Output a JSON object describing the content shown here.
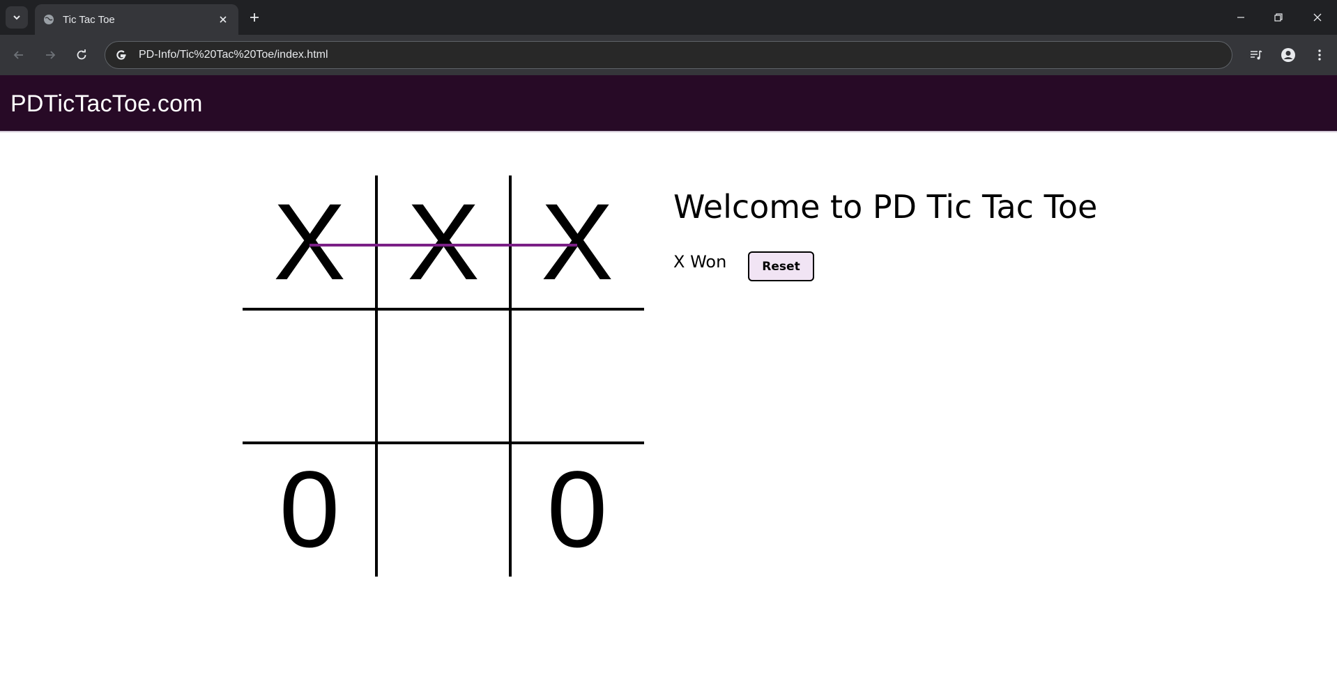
{
  "browser": {
    "tab_title": "Tic Tac Toe",
    "url": "PD-Info/Tic%20Tac%20Toe/index.html",
    "icons": {
      "tab_search": "chevron-down-icon",
      "favicon": "globe-icon",
      "tab_close": "close-icon",
      "new_tab": "plus-icon",
      "back": "arrow-left-icon",
      "forward": "arrow-right-icon",
      "reload": "reload-icon",
      "site_info": "google-icon",
      "media": "media-control-icon",
      "profile": "profile-icon",
      "menu": "kebab-menu-icon",
      "minimize": "minimize-icon",
      "restore": "restore-icon",
      "close_window": "close-window-icon"
    }
  },
  "site": {
    "brand": "PDTicTacToe.com",
    "header_color": "#270a26"
  },
  "game": {
    "board": [
      [
        "X",
        "X",
        "X"
      ],
      [
        "",
        "",
        ""
      ],
      [
        "0",
        "",
        "0"
      ]
    ],
    "winning_line": "top-row",
    "winning_line_color": "#7b1f86"
  },
  "info": {
    "heading": "Welcome to PD Tic Tac Toe",
    "status": "X Won",
    "reset_label": "Reset"
  }
}
